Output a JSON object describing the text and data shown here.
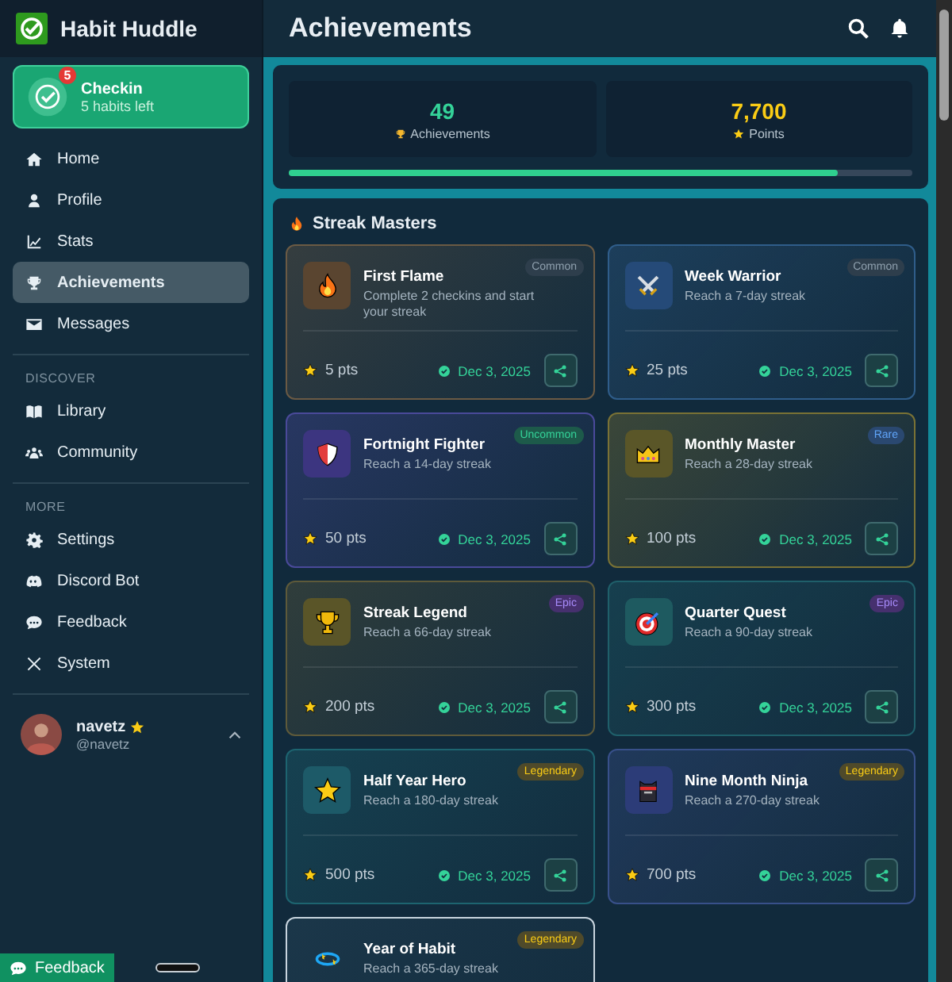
{
  "app": {
    "name": "Habit Huddle"
  },
  "checkin": {
    "title": "Checkin",
    "subtitle": "5 habits left",
    "badge": "5"
  },
  "nav": [
    {
      "items": [
        {
          "label": "Home",
          "selected": false
        },
        {
          "label": "Profile",
          "selected": false
        },
        {
          "label": "Stats",
          "selected": false
        },
        {
          "label": "Achievements",
          "selected": true
        },
        {
          "label": "Messages",
          "selected": false
        }
      ]
    },
    {
      "heading": "DISCOVER",
      "items": [
        {
          "label": "Library",
          "selected": false
        },
        {
          "label": "Community",
          "selected": false
        }
      ]
    },
    {
      "heading": "MORE",
      "items": [
        {
          "label": "Settings",
          "selected": false
        },
        {
          "label": "Discord Bot",
          "selected": false
        },
        {
          "label": "Feedback",
          "selected": false
        },
        {
          "label": "System",
          "selected": false
        }
      ]
    }
  ],
  "user": {
    "name": "navetz",
    "handle": "@navetz"
  },
  "feedback_button": {
    "label": "Feedback"
  },
  "header": {
    "title": "Achievements"
  },
  "summary": {
    "achievements": {
      "value": "49",
      "label": "Achievements"
    },
    "points": {
      "value": "7,700",
      "label": "Points"
    },
    "progress": {
      "level": 0.88
    }
  },
  "section": {
    "title": "Streak Masters",
    "cards": [
      {
        "title": "First Flame",
        "description": "Complete 2 checkins and start your streak",
        "rarity": "Common",
        "kind": "common",
        "color": "#6b5a44",
        "points": "5 pts",
        "date": "Dec 3, 2025",
        "selected": false
      },
      {
        "title": "Week Warrior",
        "description": "Reach a 7-day streak",
        "rarity": "Common",
        "kind": "common",
        "color": "#2f5d8a",
        "points": "25 pts",
        "date": "Dec 3, 2025",
        "selected": false
      },
      {
        "title": "Fortnight Fighter",
        "description": "Reach a 14-day streak",
        "rarity": "Uncommon",
        "kind": "uncommon",
        "color": "#4a4a9a",
        "points": "50 pts",
        "date": "Dec 3, 2025",
        "selected": false
      },
      {
        "title": "Monthly Master",
        "description": "Reach a 28-day streak",
        "rarity": "Rare",
        "kind": "rare",
        "color": "#7a7235",
        "points": "100 pts",
        "date": "Dec 3, 2025",
        "selected": false
      },
      {
        "title": "Streak Legend",
        "description": "Reach a 66-day streak",
        "rarity": "Epic",
        "kind": "epic",
        "color": "#5e5a3a",
        "points": "200 pts",
        "date": "Dec 3, 2025",
        "selected": false
      },
      {
        "title": "Quarter Quest",
        "description": "Reach a 90-day streak",
        "rarity": "Epic",
        "kind": "epic",
        "color": "#1f5f6a",
        "points": "300 pts",
        "date": "Dec 3, 2025",
        "selected": false
      },
      {
        "title": "Half Year Hero",
        "description": "Reach a 180-day streak",
        "rarity": "Legendary",
        "kind": "legendary",
        "color": "#1d6470",
        "points": "500 pts",
        "date": "Dec 3, 2025",
        "selected": false
      },
      {
        "title": "Nine Month Ninja",
        "description": "Reach a 270-day streak",
        "rarity": "Legendary",
        "kind": "legendary",
        "color": "#38508a",
        "points": "700 pts",
        "date": "Dec 3, 2025",
        "selected": false
      },
      {
        "title": "Year of Habit",
        "description": "Reach a 365-day streak",
        "rarity": "Legendary",
        "kind": "legendary",
        "selected": true
      }
    ]
  }
}
